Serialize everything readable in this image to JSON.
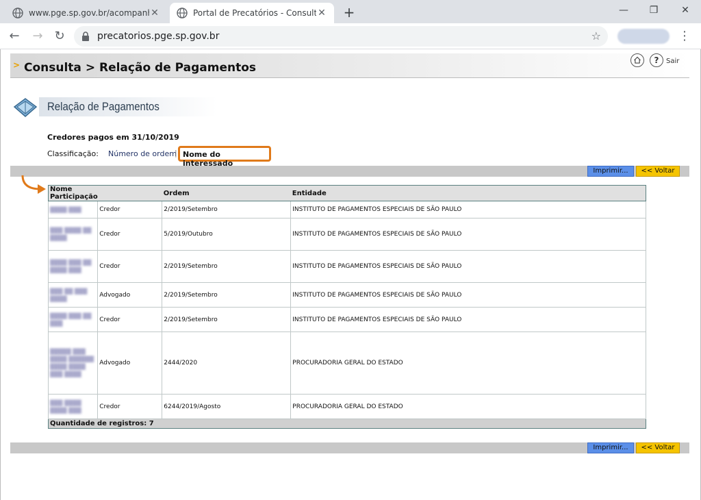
{
  "browser": {
    "tabs": [
      {
        "label": "www.pge.sp.gov.br/acompanhe/",
        "active": false
      },
      {
        "label": "Portal de Precatórios - Consulta",
        "active": true
      }
    ],
    "new_tab": "+",
    "window_controls": {
      "minimize": "—",
      "restore": "❐",
      "close": "✕"
    },
    "url": "precatorios.pge.sp.gov.br"
  },
  "header": {
    "title": "Consulta > Relação de Pagamentos",
    "sair_label": "Sair",
    "help_label": "?"
  },
  "section": {
    "title": "Relação de Pagamentos",
    "credores_text": "Credores pagos em 31/10/2019",
    "classificacao_label": "Classificação:",
    "sort_by_number": "Número de ordem",
    "separator": "|",
    "sort_by_name": "Nome do interessado"
  },
  "buttons": {
    "print": "Imprimir...",
    "back": "<< Voltar"
  },
  "table": {
    "headers": {
      "name": "Nome",
      "participacao": "Participação",
      "ordem": "Ordem",
      "entidade": "Entidade"
    },
    "rows": [
      {
        "name": "Nome oculto",
        "participacao": "Credor",
        "ordem": "2/2019/Setembro",
        "entidade": "INSTITUTO DE PAGAMENTOS ESPECIAIS DE SÃO PAULO"
      },
      {
        "name": "Nome oculto",
        "participacao": "Credor",
        "ordem": "5/2019/Outubro",
        "entidade": "INSTITUTO DE PAGAMENTOS ESPECIAIS DE SÃO PAULO"
      },
      {
        "name": "Nome oculto",
        "participacao": "Credor",
        "ordem": "2/2019/Setembro",
        "entidade": "INSTITUTO DE PAGAMENTOS ESPECIAIS DE SÃO PAULO"
      },
      {
        "name": "Nome oculto",
        "participacao": "Advogado",
        "ordem": "2/2019/Setembro",
        "entidade": "INSTITUTO DE PAGAMENTOS ESPECIAIS DE SÃO PAULO"
      },
      {
        "name": "Nome oculto",
        "participacao": "Credor",
        "ordem": "2/2019/Setembro",
        "entidade": "INSTITUTO DE PAGAMENTOS ESPECIAIS DE SÃO PAULO"
      },
      {
        "name": "Nome oculto",
        "participacao": "Advogado",
        "ordem": "2444/2020",
        "entidade": "PROCURADORIA GERAL DO ESTADO"
      },
      {
        "name": "Nome oculto",
        "participacao": "Credor",
        "ordem": "6244/2019/Agosto",
        "entidade": "PROCURADORIA GERAL DO ESTADO"
      }
    ],
    "footer": "Quantidade de registros: 7"
  },
  "colors": {
    "accent_orange": "#e07a1a",
    "print_blue": "#5b8fe8",
    "back_yellow": "#f5c400"
  }
}
